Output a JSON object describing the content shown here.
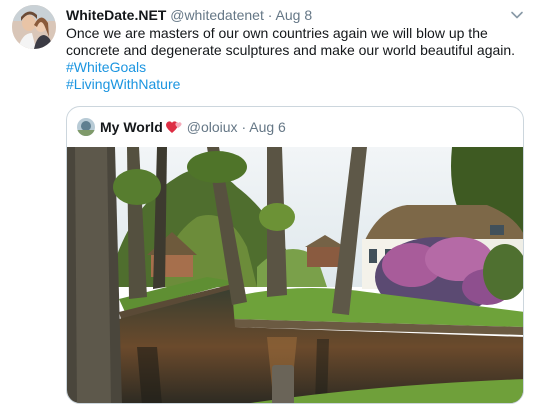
{
  "tweet": {
    "display_name": "WhiteDate.NET",
    "handle": "@whitedatenet",
    "separator": "·",
    "time": "Aug 8",
    "text": "Once we are masters of our own countries again we will blow up the concrete and degenerate sculptures and make our world beautiful again.",
    "hashtags": [
      "#WhiteGoals",
      "#LivingWithNature"
    ],
    "icons": {
      "avatar": "profile-photo",
      "menu": "chevron-down-icon"
    }
  },
  "quoted": {
    "display_name": "My World",
    "emoji": "💞",
    "handle": "@oloiux",
    "separator": "·",
    "time": "Aug 6",
    "image": "canal-village-photo"
  },
  "colors": {
    "link": "#1b95e0",
    "secondary_text": "#657786",
    "border": "#ccd6dd"
  }
}
